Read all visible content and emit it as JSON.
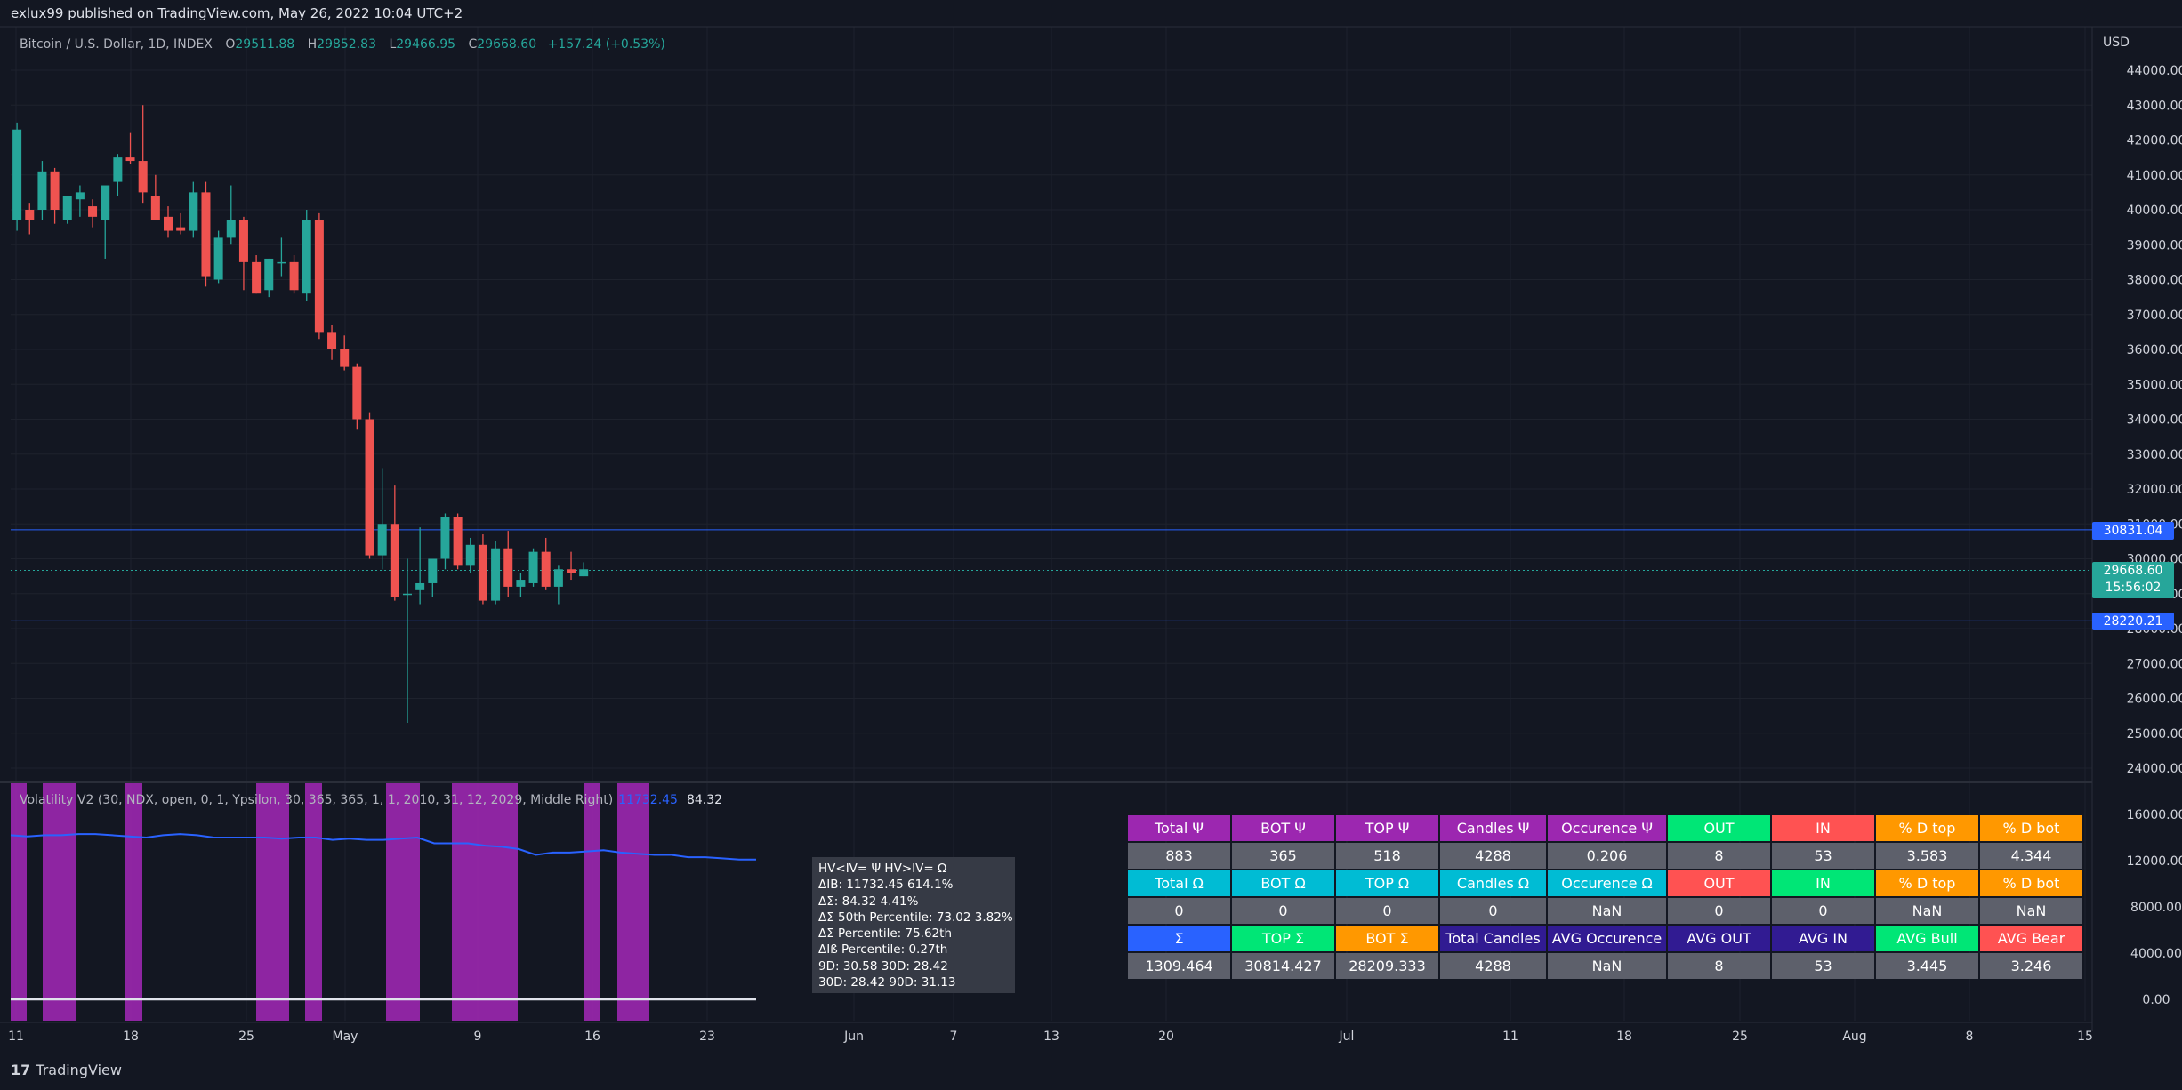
{
  "header": {
    "publisher": "exlux99 published on TradingView.com, May 26, 2022 10:04 UTC+2",
    "symbol": "Bitcoin / U.S. Dollar, 1D, INDEX",
    "ohlc": [
      {
        "k": "O",
        "v": "29511.88"
      },
      {
        "k": "H",
        "v": "29852.83"
      },
      {
        "k": "L",
        "v": "29466.95"
      },
      {
        "k": "C",
        "v": "29668.60"
      }
    ],
    "change": "+157.24 (+0.53%)",
    "currency": "USD"
  },
  "indicator": {
    "label": "Volatility V2 (30, NDX, open, 0, 1, Ypsilon, 30, 365, 365, 1, 1, 2010, 31, 12, 2029, Middle Right)",
    "value1": "11732.45",
    "value2": "84.32"
  },
  "price_tags": [
    {
      "text": "30831.04",
      "color": "#2962ff"
    },
    {
      "text": "29668.60",
      "sub": "15:56:02",
      "color": "#26a69a"
    },
    {
      "text": "28220.21",
      "color": "#2962ff"
    }
  ],
  "info_box": [
    "HV<IV= Ψ  HV>IV= Ω",
    "ΔIB: 11732.45  614.1%",
    "ΔΣ: 84.32  4.41%",
    "ΔΣ 50th Percentile: 73.02  3.82%",
    "ΔΣ Percentile: 75.62th",
    "ΔIß Percentile: 0.27th",
    "9D: 30.58  30D: 28.42",
    "30D: 28.42  90D: 31.13"
  ],
  "table": [
    [
      {
        "t": "Total Ψ",
        "bg": "#9c27b0"
      },
      {
        "t": "BOT Ψ",
        "bg": "#9c27b0"
      },
      {
        "t": "TOP Ψ",
        "bg": "#9c27b0"
      },
      {
        "t": "Candles Ψ",
        "bg": "#9c27b0"
      },
      {
        "t": "Occurence Ψ",
        "bg": "#9c27b0"
      },
      {
        "t": "OUT",
        "bg": "#00e676"
      },
      {
        "t": "IN",
        "bg": "#ff5252"
      },
      {
        "t": "% D top",
        "bg": "#ff9800"
      },
      {
        "t": "% D bot",
        "bg": "#ff9800"
      }
    ],
    [
      {
        "t": "883",
        "bg": "#5d606b"
      },
      {
        "t": "365",
        "bg": "#5d606b"
      },
      {
        "t": "518",
        "bg": "#5d606b"
      },
      {
        "t": "4288",
        "bg": "#5d606b"
      },
      {
        "t": "0.206",
        "bg": "#5d606b"
      },
      {
        "t": "8",
        "bg": "#5d606b"
      },
      {
        "t": "53",
        "bg": "#5d606b"
      },
      {
        "t": "3.583",
        "bg": "#5d606b"
      },
      {
        "t": "4.344",
        "bg": "#5d606b"
      }
    ],
    [
      {
        "t": "Total Ω",
        "bg": "#00bcd4"
      },
      {
        "t": "BOT Ω",
        "bg": "#00bcd4"
      },
      {
        "t": "TOP Ω",
        "bg": "#00bcd4"
      },
      {
        "t": "Candles Ω",
        "bg": "#00bcd4"
      },
      {
        "t": "Occurence Ω",
        "bg": "#00bcd4"
      },
      {
        "t": "OUT",
        "bg": "#ff5252"
      },
      {
        "t": "IN",
        "bg": "#00e676"
      },
      {
        "t": "% D top",
        "bg": "#ff9800"
      },
      {
        "t": "% D bot",
        "bg": "#ff9800"
      }
    ],
    [
      {
        "t": "0",
        "bg": "#5d606b"
      },
      {
        "t": "0",
        "bg": "#5d606b"
      },
      {
        "t": "0",
        "bg": "#5d606b"
      },
      {
        "t": "0",
        "bg": "#5d606b"
      },
      {
        "t": "NaN",
        "bg": "#5d606b"
      },
      {
        "t": "0",
        "bg": "#5d606b"
      },
      {
        "t": "0",
        "bg": "#5d606b"
      },
      {
        "t": "NaN",
        "bg": "#5d606b"
      },
      {
        "t": "NaN",
        "bg": "#5d606b"
      }
    ],
    [
      {
        "t": "Σ",
        "bg": "#2962ff"
      },
      {
        "t": "TOP Σ",
        "bg": "#00e676"
      },
      {
        "t": "BOT Σ",
        "bg": "#ff9800"
      },
      {
        "t": "Total Candles",
        "bg": "#311b92"
      },
      {
        "t": "AVG Occurence",
        "bg": "#311b92"
      },
      {
        "t": "AVG OUT",
        "bg": "#311b92"
      },
      {
        "t": "AVG IN",
        "bg": "#311b92"
      },
      {
        "t": "AVG Bull",
        "bg": "#00e676"
      },
      {
        "t": "AVG Bear",
        "bg": "#ff5252"
      }
    ],
    [
      {
        "t": "1309.464",
        "bg": "#5d606b"
      },
      {
        "t": "30814.427",
        "bg": "#5d606b"
      },
      {
        "t": "28209.333",
        "bg": "#5d606b"
      },
      {
        "t": "4288",
        "bg": "#5d606b"
      },
      {
        "t": "NaN",
        "bg": "#5d606b"
      },
      {
        "t": "8",
        "bg": "#5d606b"
      },
      {
        "t": "53",
        "bg": "#5d606b"
      },
      {
        "t": "3.445",
        "bg": "#5d606b"
      },
      {
        "t": "3.246",
        "bg": "#5d606b"
      }
    ]
  ],
  "footer": {
    "logo_mark": "17",
    "logo_text": "TradingView"
  },
  "chart_data": {
    "type": "candlestick",
    "title": "Bitcoin / U.S. Dollar, 1D, INDEX",
    "x_ticks": [
      "11",
      "18",
      "25",
      "May",
      "9",
      "16",
      "23",
      "Jun",
      "7",
      "13",
      "20",
      "Jul",
      "11",
      "18",
      "25",
      "Aug",
      "8",
      "15"
    ],
    "y_ticks": [
      "44000.00",
      "43000.00",
      "42000.00",
      "41000.00",
      "40000.00",
      "39000.00",
      "38000.00",
      "37000.00",
      "36000.00",
      "35000.00",
      "34000.00",
      "33000.00",
      "32000.00",
      "31000.00",
      "30000.00",
      "29000.00",
      "28000.00",
      "27000.00",
      "26000.00",
      "25000.00",
      "24000.00"
    ],
    "ylim": [
      23400,
      44800
    ],
    "candles": [
      {
        "o": 39700,
        "h": 42500,
        "l": 39400,
        "c": 42300
      },
      {
        "o": 40000,
        "h": 40200,
        "l": 39300,
        "c": 39700
      },
      {
        "o": 40000,
        "h": 41400,
        "l": 39700,
        "c": 41100
      },
      {
        "o": 41100,
        "h": 41200,
        "l": 39600,
        "c": 40000
      },
      {
        "o": 39700,
        "h": 40100,
        "l": 39600,
        "c": 40400
      },
      {
        "o": 40300,
        "h": 40700,
        "l": 39800,
        "c": 40500
      },
      {
        "o": 40100,
        "h": 40300,
        "l": 39500,
        "c": 39800
      },
      {
        "o": 39700,
        "h": 40100,
        "l": 38600,
        "c": 40700
      },
      {
        "o": 40800,
        "h": 41600,
        "l": 40400,
        "c": 41500
      },
      {
        "o": 41500,
        "h": 42200,
        "l": 41300,
        "c": 41400
      },
      {
        "o": 41400,
        "h": 43000,
        "l": 40200,
        "c": 40500
      },
      {
        "o": 40400,
        "h": 41000,
        "l": 39700,
        "c": 39700
      },
      {
        "o": 39800,
        "h": 40100,
        "l": 39200,
        "c": 39400
      },
      {
        "o": 39500,
        "h": 39900,
        "l": 39300,
        "c": 39400
      },
      {
        "o": 39400,
        "h": 40800,
        "l": 39200,
        "c": 40500
      },
      {
        "o": 40500,
        "h": 40800,
        "l": 37800,
        "c": 38100
      },
      {
        "o": 38000,
        "h": 39400,
        "l": 37900,
        "c": 39200
      },
      {
        "o": 39200,
        "h": 40700,
        "l": 39000,
        "c": 39700
      },
      {
        "o": 39700,
        "h": 39800,
        "l": 37700,
        "c": 38500
      },
      {
        "o": 38500,
        "h": 38700,
        "l": 37600,
        "c": 37600
      },
      {
        "o": 37700,
        "h": 38600,
        "l": 37500,
        "c": 38600
      },
      {
        "o": 38500,
        "h": 39200,
        "l": 38100,
        "c": 38500
      },
      {
        "o": 38500,
        "h": 38700,
        "l": 37600,
        "c": 37700
      },
      {
        "o": 37600,
        "h": 40000,
        "l": 37400,
        "c": 39700
      },
      {
        "o": 39700,
        "h": 39900,
        "l": 36300,
        "c": 36500
      },
      {
        "o": 36500,
        "h": 36700,
        "l": 35700,
        "c": 36000
      },
      {
        "o": 36000,
        "h": 36400,
        "l": 35400,
        "c": 35500
      },
      {
        "o": 35500,
        "h": 35600,
        "l": 33700,
        "c": 34000
      },
      {
        "o": 34000,
        "h": 34200,
        "l": 30000,
        "c": 30100
      },
      {
        "o": 30100,
        "h": 32600,
        "l": 29700,
        "c": 31000
      },
      {
        "o": 31000,
        "h": 32100,
        "l": 28800,
        "c": 28900
      },
      {
        "o": 29000,
        "h": 30000,
        "l": 25300,
        "c": 29000
      },
      {
        "o": 29100,
        "h": 30900,
        "l": 28700,
        "c": 29300
      },
      {
        "o": 29300,
        "h": 29800,
        "l": 28900,
        "c": 30000
      },
      {
        "o": 30000,
        "h": 31300,
        "l": 29700,
        "c": 31200
      },
      {
        "o": 31200,
        "h": 31300,
        "l": 29700,
        "c": 29800
      },
      {
        "o": 29800,
        "h": 30600,
        "l": 29600,
        "c": 30400
      },
      {
        "o": 30400,
        "h": 30700,
        "l": 28700,
        "c": 28800
      },
      {
        "o": 28800,
        "h": 30500,
        "l": 28700,
        "c": 30300
      },
      {
        "o": 30300,
        "h": 30800,
        "l": 28900,
        "c": 29200
      },
      {
        "o": 29200,
        "h": 29600,
        "l": 28900,
        "c": 29400
      },
      {
        "o": 29300,
        "h": 30300,
        "l": 29200,
        "c": 30200
      },
      {
        "o": 30200,
        "h": 30600,
        "l": 29100,
        "c": 29200
      },
      {
        "o": 29200,
        "h": 29800,
        "l": 28700,
        "c": 29700
      },
      {
        "o": 29700,
        "h": 30200,
        "l": 29400,
        "c": 29600
      },
      {
        "o": 29500,
        "h": 29900,
        "l": 29500,
        "c": 29700
      }
    ],
    "levels": [
      {
        "value": 30831.04,
        "color": "#2962ff"
      },
      {
        "value": 29668.6,
        "color": "#26a69a",
        "dotted": true
      },
      {
        "value": 28220.21,
        "color": "#2962ff"
      }
    ],
    "indicator_pane": {
      "y_ticks": [
        "16000.00",
        "12000.00",
        "8000.00",
        "4000.00",
        "0.00"
      ],
      "ylim": [
        -800,
        17600
      ],
      "highlight_bars": [
        0,
        3,
        4,
        5,
        11,
        22,
        23,
        25,
        26,
        36,
        37,
        38,
        39,
        40,
        41,
        42,
        51,
        55,
        56,
        57
      ],
      "series": [
        {
          "values": [
            14200,
            14100,
            14200,
            14200,
            14300,
            14300,
            14200,
            14100,
            14000,
            14200,
            14300,
            14200,
            14000,
            14000,
            14000,
            14000,
            13900,
            14000,
            14000,
            13800,
            13900,
            13800,
            13800,
            13900,
            14000,
            13500,
            13500,
            13500,
            13300,
            13200,
            13000,
            12500,
            12700,
            12700,
            12800,
            12900,
            12700,
            12600,
            12500,
            12500,
            12300,
            12300,
            12200,
            12100,
            12100
          ],
          "color": "#2962ff"
        },
        {
          "values": [
            0,
            0,
            0,
            0,
            0,
            0,
            0,
            0,
            0,
            0,
            0,
            0,
            0,
            0,
            0,
            0,
            0,
            0,
            0,
            0,
            0,
            0,
            0,
            0,
            0,
            0,
            0,
            0,
            0,
            0,
            0,
            0,
            0,
            0,
            0,
            0,
            0,
            0,
            0,
            0,
            0,
            0,
            0,
            0,
            0
          ],
          "color": "#e0e3eb"
        }
      ]
    }
  }
}
